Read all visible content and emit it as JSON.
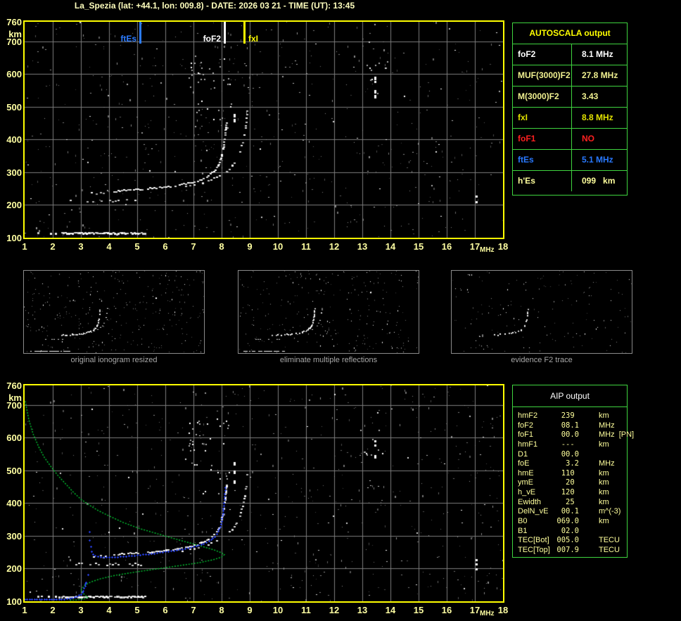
{
  "title": "La_Spezia (lat: +44.1, lon: 009.8) - DATE: 2026 03 21 - TIME (UT): 13:45",
  "colors": {
    "background": "#000000",
    "axis_border_yellow": "#ffff00",
    "tick_label_yellow": "#ffffa2",
    "grid_gray": "#7d7d7d",
    "table_border_green": "#3fd43f",
    "profile_green": "#00cc33",
    "fitted_trace_blue": "#2b46ff",
    "echo_white": "#ffffff",
    "noise_gray": "#aaaaaa",
    "caption_gray": "#a8a8a8"
  },
  "autoscala_table": {
    "header": "AUTOSCALA output",
    "rows": [
      {
        "label": "foF2",
        "value": "8.1 MHz",
        "color": "#ffffff"
      },
      {
        "label": "MUF(3000)F2",
        "value": "27.8 MHz",
        "color": "#f0f090"
      },
      {
        "label": "M(3000)F2",
        "value": "3.43",
        "color": "#f0f090"
      },
      {
        "label": "fxI",
        "value": "8.8 MHz",
        "color": "#e2e200"
      },
      {
        "label": "foF1",
        "value": "NO",
        "color": "#ff2020"
      },
      {
        "label": "ftEs",
        "value": "5.1 MHz",
        "color": "#2979ff"
      },
      {
        "label": "h'Es",
        "value": "099   km",
        "color": "#ffff9c"
      }
    ]
  },
  "aip_table": {
    "header": "AIP output",
    "rows": [
      {
        "label": "hmF2",
        "value": "239 ",
        "unit": "km",
        "note": ""
      },
      {
        "label": "foF2",
        "value": "08.1",
        "unit": "MHz",
        "note": ""
      },
      {
        "label": "foF1",
        "value": "00.0",
        "unit": "MHz",
        "note": "[PN]"
      },
      {
        "label": "hmF1",
        "value": "--- ",
        "unit": "km",
        "note": ""
      },
      {
        "label": "D1",
        "value": "00.0",
        "unit": "",
        "note": ""
      },
      {
        "label": "foE",
        "value": "3.2",
        "unit": "MHz",
        "note": ""
      },
      {
        "label": "hmE",
        "value": "110 ",
        "unit": "km",
        "note": ""
      },
      {
        "label": "ymE",
        "value": "20 ",
        "unit": "km",
        "note": ""
      },
      {
        "label": "h_vE",
        "value": "120 ",
        "unit": "km",
        "note": ""
      },
      {
        "label": "Ewidth",
        "value": "25 ",
        "unit": "km",
        "note": ""
      },
      {
        "label": "DelN_vE",
        "value": "00.1",
        "unit": "m^(-3)",
        "note": ""
      },
      {
        "label": "B0",
        "value": "069.0",
        "unit": "km",
        "note": ""
      },
      {
        "label": "B1",
        "value": "02.0",
        "unit": "",
        "note": ""
      },
      {
        "label": "TEC[Bot]",
        "value": "005.0",
        "unit": "TECU",
        "note": ""
      },
      {
        "label": "TEC[Top]",
        "value": "007.9",
        "unit": "TECU",
        "note": ""
      }
    ]
  },
  "panels": [
    {
      "caption": "original ionogram resized"
    },
    {
      "caption": "eliminate multiple reflections"
    },
    {
      "caption": "evidence F2 trace"
    }
  ],
  "chart_data": {
    "type": "scatter",
    "title": "ionogram with autoscaled traces",
    "xlabel": "MHz",
    "ylabel": "km",
    "xlim": [
      1,
      18
    ],
    "ylim": [
      100,
      760
    ],
    "x_ticks": [
      1,
      2,
      3,
      4,
      5,
      6,
      7,
      8,
      9,
      10,
      11,
      12,
      13,
      14,
      15,
      16,
      17,
      18
    ],
    "y_ticks": [
      760,
      700,
      600,
      500,
      400,
      300,
      200,
      100
    ],
    "grid": true,
    "top_markers": [
      {
        "label": "ftEs",
        "freq": 5.1,
        "color": "#2b7bff",
        "side": "left"
      },
      {
        "label": "foF2",
        "freq": 8.1,
        "color": "#ffffff",
        "side": "left"
      },
      {
        "label": "fxI",
        "freq": 8.8,
        "color": "#ffff00",
        "side": "right"
      }
    ],
    "echo_traces": {
      "es_layer": {
        "km": 116,
        "segments": [
          {
            "f": [
              1.45,
              2.3
            ],
            "density": 0.4
          },
          {
            "f": [
              2.3,
              5.25
            ],
            "density": 0.95
          }
        ]
      },
      "multiple_reflection_band": {
        "km": 215,
        "f": [
          2.6,
          5.3
        ],
        "density": 0.5
      },
      "f2_lead": [
        [
          3.35,
          236
        ],
        [
          3.6,
          238
        ],
        [
          3.85,
          240
        ],
        [
          4.1,
          242
        ]
      ],
      "f2_ordinary": [
        [
          4.15,
          243
        ],
        [
          4.5,
          247
        ],
        [
          5.0,
          250
        ],
        [
          5.5,
          253
        ],
        [
          6.0,
          257
        ],
        [
          6.4,
          262
        ],
        [
          6.7,
          266
        ],
        [
          7.0,
          272
        ],
        [
          7.25,
          280
        ],
        [
          7.5,
          291
        ],
        [
          7.7,
          305
        ],
        [
          7.85,
          322
        ],
        [
          7.95,
          345
        ],
        [
          8.03,
          375
        ],
        [
          8.08,
          405
        ],
        [
          8.12,
          435
        ],
        [
          8.15,
          458
        ]
      ],
      "f2_extraordinary": [
        [
          6.3,
          252
        ],
        [
          6.7,
          258
        ],
        [
          7.0,
          263
        ],
        [
          7.3,
          270
        ],
        [
          7.6,
          279
        ],
        [
          7.9,
          291
        ],
        [
          8.15,
          305
        ],
        [
          8.35,
          322
        ],
        [
          8.5,
          342
        ],
        [
          8.62,
          365
        ],
        [
          8.72,
          392
        ],
        [
          8.8,
          425
        ],
        [
          8.85,
          455
        ],
        [
          8.88,
          488
        ]
      ],
      "vertical_echoes": [
        {
          "f": 13.45,
          "km_start": 528,
          "km_end": 592
        },
        {
          "f": 8.45,
          "km_start": 455,
          "km_end": 525
        },
        {
          "f": 17.05,
          "km_start": 165,
          "km_end": 228
        }
      ],
      "noise_clusters": [
        {
          "f": [
            6.8,
            8.3
          ],
          "km": [
            560,
            660
          ],
          "count": 26
        },
        {
          "f": [
            7.0,
            8.4
          ],
          "km": [
            430,
            520
          ],
          "count": 12
        },
        {
          "f": [
            12.9,
            13.9
          ],
          "km": [
            540,
            640
          ],
          "count": 10
        }
      ]
    },
    "profile_green": [
      [
        1.02,
        712
      ],
      [
        1.15,
        655
      ],
      [
        1.3,
        612
      ],
      [
        1.5,
        572
      ],
      [
        1.7,
        540
      ],
      [
        1.95,
        510
      ],
      [
        2.2,
        483
      ],
      [
        2.5,
        455
      ],
      [
        2.75,
        432
      ],
      [
        3.0,
        412
      ],
      [
        3.25,
        397
      ],
      [
        3.6,
        378
      ],
      [
        4.0,
        361
      ],
      [
        4.5,
        341
      ],
      [
        5.1,
        322
      ],
      [
        5.7,
        307
      ],
      [
        6.3,
        292
      ],
      [
        6.8,
        280
      ],
      [
        7.3,
        268
      ],
      [
        7.7,
        258
      ],
      [
        7.95,
        250
      ],
      [
        8.1,
        243
      ],
      [
        8.0,
        235
      ],
      [
        7.7,
        227
      ],
      [
        7.2,
        218
      ],
      [
        6.5,
        209
      ],
      [
        5.7,
        199
      ],
      [
        4.9,
        189
      ],
      [
        4.2,
        179
      ],
      [
        3.7,
        169
      ],
      [
        3.35,
        159
      ],
      [
        3.15,
        150
      ],
      [
        3.05,
        141
      ],
      [
        3.0,
        133
      ],
      [
        3.06,
        126
      ],
      [
        3.16,
        118
      ],
      [
        3.24,
        112
      ],
      [
        3.1,
        107
      ],
      [
        2.85,
        104
      ],
      [
        2.55,
        103
      ]
    ],
    "fitted_trace_blue": {
      "e_branch": [
        [
          1.0,
          106
        ],
        [
          2.3,
          106
        ],
        [
          2.6,
          109
        ],
        [
          2.85,
          115
        ],
        [
          3.0,
          122
        ],
        [
          3.08,
          133
        ],
        [
          3.14,
          147
        ],
        [
          3.17,
          159
        ]
      ],
      "cusp_points": [
        [
          3.25,
          182
        ],
        [
          3.3,
          313
        ],
        [
          3.31,
          287
        ],
        [
          3.34,
          267
        ],
        [
          3.37,
          252
        ],
        [
          3.42,
          244
        ]
      ],
      "f_branch": [
        [
          3.5,
          239
        ],
        [
          3.7,
          236
        ],
        [
          4.0,
          235
        ],
        [
          4.4,
          237
        ],
        [
          4.8,
          240
        ],
        [
          5.2,
          243
        ],
        [
          5.6,
          247
        ],
        [
          6.0,
          252
        ],
        [
          6.4,
          257
        ],
        [
          6.8,
          263
        ],
        [
          7.1,
          269
        ],
        [
          7.35,
          276
        ],
        [
          7.55,
          284
        ],
        [
          7.75,
          297
        ],
        [
          7.88,
          314
        ],
        [
          7.97,
          336
        ],
        [
          8.03,
          362
        ],
        [
          8.07,
          392
        ],
        [
          8.1,
          420
        ],
        [
          8.12,
          448
        ]
      ]
    },
    "noise": {
      "seed_top": 7,
      "seed_bottom": 41,
      "gray_dots": 540,
      "white_dots": 90
    },
    "panel_noise": [
      {
        "seed": 11,
        "dots": 300
      },
      {
        "seed": 23,
        "dots": 255
      },
      {
        "seed": 31,
        "dots": 150
      }
    ]
  }
}
